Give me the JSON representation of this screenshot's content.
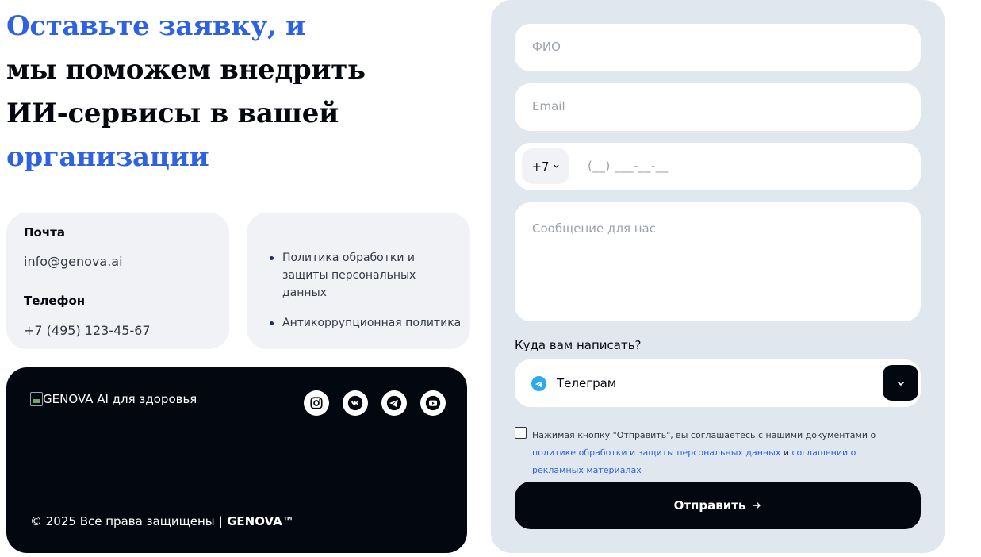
{
  "heading": {
    "line1": "Оставьте заявку, и",
    "line2": "мы поможем внедрить",
    "line3": "ИИ-сервисы в вашей",
    "line4": "организации"
  },
  "contacts": {
    "mail_label": "Почта",
    "mail_value": "info@genova.ai",
    "phone_label": "Телефон",
    "phone_value": "+7 (495) 123-45-67"
  },
  "documents": [
    {
      "label": "Политика обработки и защиты персональных данных"
    },
    {
      "label": "Антикоррупционная политика"
    }
  ],
  "footer": {
    "logo_alt": "GENOVA AI для здоровья",
    "copyright_text": "© 2025 Все права защищены ",
    "brand": "| GENOVA™",
    "socials": [
      "instagram-icon",
      "vk-icon",
      "telegram-icon",
      "youtube-icon"
    ]
  },
  "form": {
    "name_placeholder": "ФИО",
    "email_placeholder": "Email",
    "country_code": "+7",
    "phone_placeholder": "(__) ___-__-__",
    "message_placeholder": "Сообщение для нас",
    "where_label": "Куда вам написать?",
    "where_value": "Телеграм",
    "agree_prefix": "Нажимая кнопку \"Отправить\", вы соглашаетесь с нашими документами о ",
    "agree_link1": "политике обработки и защиты персональных данных",
    "agree_mid": " и ",
    "agree_link2": "соглашении о рекламных материалах",
    "submit_label": "Отправить"
  },
  "colors": {
    "accent": "#2f62e0",
    "dark": "#03070f",
    "panel": "#e1e7ef",
    "card": "#f1f2f5",
    "telegram": "#2aabee"
  }
}
